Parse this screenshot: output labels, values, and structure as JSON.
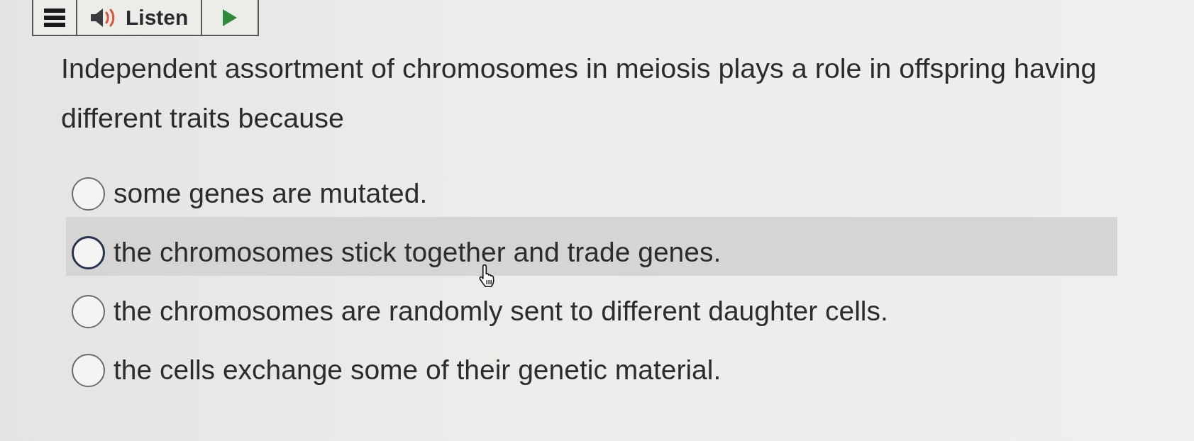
{
  "toolbar": {
    "listen_label": "Listen"
  },
  "question": {
    "text": "Independent assortment of chromosomes in meiosis plays a role in offspring having different traits because"
  },
  "options": [
    {
      "text": "some genes are mutated.",
      "selected": false,
      "highlighted": false
    },
    {
      "text": "the chromosomes stick together and trade genes.",
      "selected": false,
      "highlighted": true
    },
    {
      "text": "the chromosomes are randomly sent to different daughter cells.",
      "selected": false,
      "highlighted": false
    },
    {
      "text": "the cells exchange some of their genetic material.",
      "selected": false,
      "highlighted": false
    }
  ]
}
